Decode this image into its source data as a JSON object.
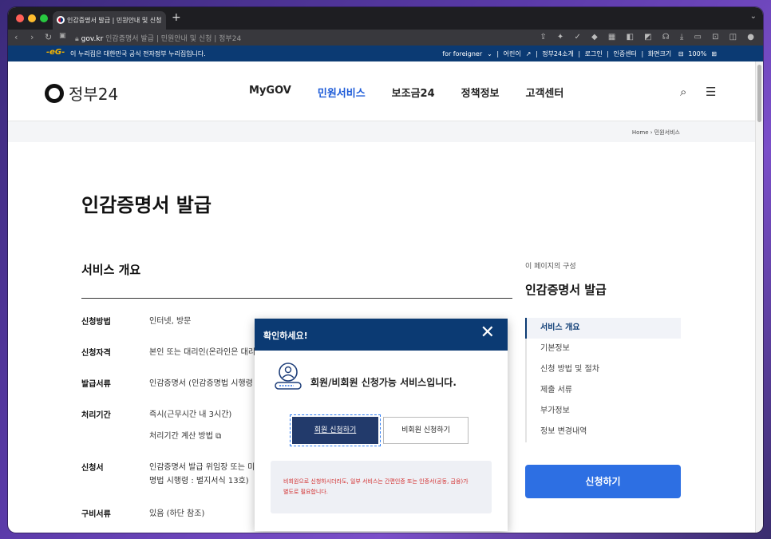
{
  "browser": {
    "tab_title": "인감증명서 발급 | 민원안내 및 신청",
    "new_tab": "+",
    "url_domain": "gov.kr",
    "url_rest": " 인감증명서 발급 | 민원안내 및 신청 | 정부24"
  },
  "govbar": {
    "eg_mark": "-eG-",
    "notice": "이 누리집은 대한민국 공식 전자정부 누리집입니다.",
    "foreigner": "for foreigner",
    "links": [
      "어린이",
      "정부24소개",
      "로그인",
      "인증센터"
    ],
    "zoom_label": "화면크기",
    "zoom_value": "100%"
  },
  "header": {
    "logo_text": "정부24",
    "nav": [
      "MyGOV",
      "민원서비스",
      "보조금24",
      "정책정보",
      "고객센터"
    ]
  },
  "breadcrumb": {
    "home": "Home",
    "current": "민원서비스"
  },
  "page": {
    "title": "인감증명서 발급",
    "section_title": "서비스 개요",
    "rows": [
      {
        "key": "신청방법",
        "value": "인터넷, 방문"
      },
      {
        "key": "신청자격",
        "value": "본인 또는 대리인(온라인은 대리"
      },
      {
        "key": "발급서류",
        "value": "인감증명서 (인감증명법 시행령"
      },
      {
        "key": "처리기간",
        "value": "즉시(근무시간 내 3시간)",
        "extra": "처리기간 계산 방법"
      },
      {
        "key": "신청서",
        "value": "인감증명서 발급 위임장 또는 미성년자의 법정대리인 한정후견인 및 성년후견인 동의서 (인감증",
        "value2": "명법 시행령 : 별지서식 13호)"
      },
      {
        "key": "구비서류",
        "value": "있음 (하단 참조)"
      }
    ]
  },
  "toc": {
    "label": "이 페이지의 구성",
    "title": "인감증명서 발급",
    "items": [
      "서비스 개요",
      "기본정보",
      "신청 방법 및 절차",
      "제출 서류",
      "부가정보",
      "정보 변경내역"
    ],
    "apply": "신청하기"
  },
  "modal": {
    "title": "확인하세요!",
    "message": "회원/비회원 신청가능 서비스입니다.",
    "member_button": "회원 신청하기",
    "guest_button": "비회원 신청하기",
    "notice_line1": "비회원으로 신청하시더라도, 일부 서비스는 간편인증 또는 인증서(공동, 금융)가",
    "notice_line2": "별도로 필요합니다."
  }
}
